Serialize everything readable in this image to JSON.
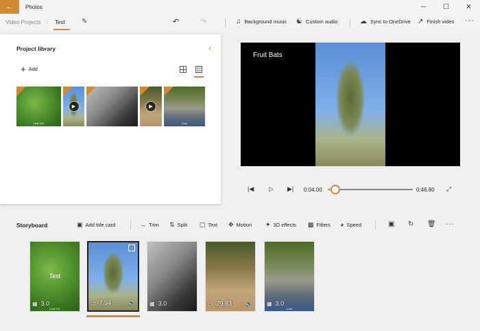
{
  "app": {
    "title": "Photos",
    "back_icon": "back-arrow-icon"
  },
  "window_controls": {
    "minimize": "─",
    "maximize": "☐",
    "close": "✕"
  },
  "breadcrumb": {
    "root": "Video Projects",
    "separator": "›",
    "current": "Test"
  },
  "toolbar": {
    "background_music": "Background music",
    "custom_audio": "Custom audio",
    "sync": "Sync to OneDrive",
    "finish": "Finish video",
    "more": "···"
  },
  "library": {
    "title": "Project library",
    "add_label": "Add",
    "collapse": "‹",
    "items": [
      {
        "name": "leaf",
        "caption": "Leaf 101",
        "is_video": false
      },
      {
        "name": "tree",
        "caption": "",
        "is_video": true
      },
      {
        "name": "family",
        "caption": "",
        "is_video": false
      },
      {
        "name": "path",
        "caption": "",
        "is_video": true
      },
      {
        "name": "croc",
        "caption": "Croc",
        "is_video": false
      }
    ]
  },
  "preview": {
    "title": "Fruit Bats",
    "current_time": "0:04.00",
    "total_time": "0:46.80",
    "progress": 0.0855
  },
  "storyboard": {
    "title": "Storyboard",
    "tools": {
      "add_title_card": "Add title card",
      "trim": "Trim",
      "split": "Split",
      "text": "Text",
      "motion": "Motion",
      "effects_3d": "3D effects",
      "filters": "Filters",
      "speed": "Speed"
    },
    "clips": [
      {
        "duration": "3.0",
        "kind": "image",
        "text": "Test",
        "caption": "Leaf 101",
        "audio": false,
        "selected": false
      },
      {
        "duration": "7.94",
        "kind": "video",
        "text": "",
        "caption": "",
        "audio": true,
        "selected": true
      },
      {
        "duration": "3.0",
        "kind": "image",
        "text": "",
        "caption": "",
        "audio": false,
        "selected": false
      },
      {
        "duration": "29.83",
        "kind": "video",
        "text": "",
        "caption": "",
        "audio": true,
        "selected": false
      },
      {
        "duration": "3.0",
        "kind": "image",
        "text": "",
        "caption": "Croc",
        "audio": false,
        "selected": false
      }
    ]
  },
  "colors": {
    "accent": "#cf8a35"
  }
}
